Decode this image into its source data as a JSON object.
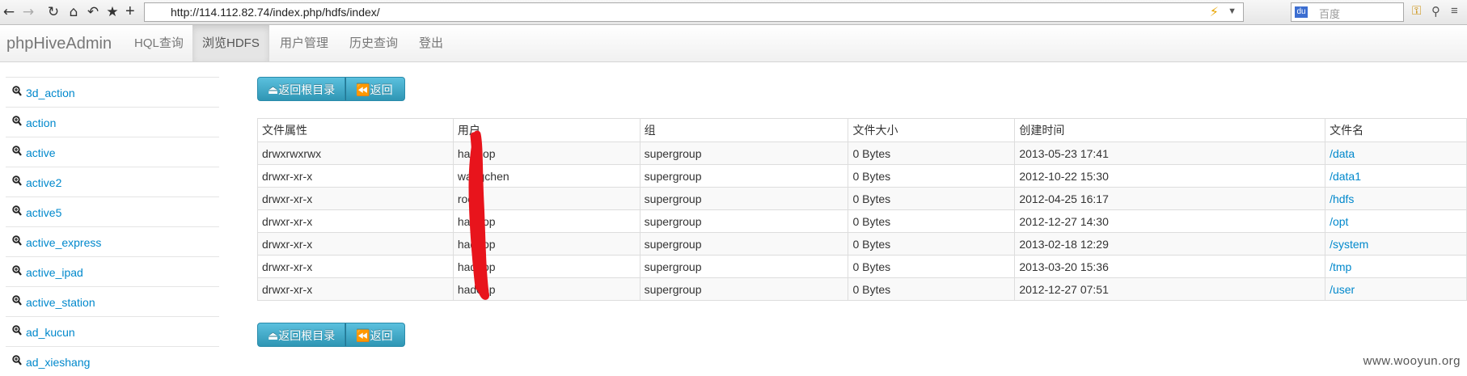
{
  "browser": {
    "url": "http://114.112.82.74/index.php/hdfs/index/",
    "search_placeholder": "百度",
    "icons": [
      "back-icon",
      "forward-icon",
      "reload-icon",
      "home-icon",
      "undo-icon",
      "bookmark-star-icon",
      "new-tab-icon",
      "lightning-icon",
      "dropdown-icon",
      "search-engine-icon",
      "key-icon",
      "user-icon",
      "menu-icon"
    ]
  },
  "navbar": {
    "brand": "phpHiveAdmin",
    "links": [
      "HQL查询",
      "浏览HDFS",
      "用户管理",
      "历史查询",
      "登出"
    ],
    "active_index": 1
  },
  "sidebar": {
    "items": [
      "3d_action",
      "action",
      "active",
      "active2",
      "active5",
      "active_express",
      "active_ipad",
      "active_station",
      "ad_kucun",
      "ad_xieshang"
    ]
  },
  "actions": {
    "root_label": "⏏返回根目录",
    "back_label": "⏪返回"
  },
  "table": {
    "headers": [
      "文件属性",
      "用户",
      "组",
      "文件大小",
      "创建时间",
      "文件名"
    ],
    "rows": [
      [
        "drwxrwxrwx",
        "hadoop",
        "supergroup",
        "0 Bytes",
        "2013-05-23 17:41",
        "/data"
      ],
      [
        "drwxr-xr-x",
        "wangchen",
        "supergroup",
        "0 Bytes",
        "2012-10-22 15:30",
        "/data1"
      ],
      [
        "drwxr-xr-x",
        "root",
        "supergroup",
        "0 Bytes",
        "2012-04-25 16:17",
        "/hdfs"
      ],
      [
        "drwxr-xr-x",
        "hadoop",
        "supergroup",
        "0 Bytes",
        "2012-12-27 14:30",
        "/opt"
      ],
      [
        "drwxr-xr-x",
        "hadoop",
        "supergroup",
        "0 Bytes",
        "2013-02-18 12:29",
        "/system"
      ],
      [
        "drwxr-xr-x",
        "hadoop",
        "supergroup",
        "0 Bytes",
        "2013-03-20 15:36",
        "/tmp"
      ],
      [
        "drwxr-xr-x",
        "hadoop",
        "supergroup",
        "0 Bytes",
        "2012-12-27 07:51",
        "/user"
      ]
    ]
  },
  "watermark": "www.wooyun.org",
  "colors": {
    "link": "#0088cc",
    "button": "#49afcd",
    "redaction": "#e8141c"
  }
}
